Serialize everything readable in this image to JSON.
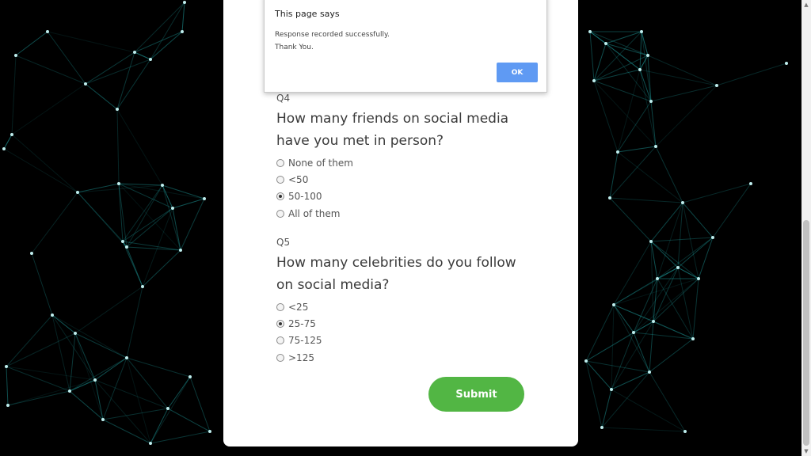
{
  "form": {
    "questions": [
      {
        "number": "Q4",
        "text": "How many friends on social media have you met in person?",
        "options": [
          {
            "label": "None of them",
            "checked": false
          },
          {
            "label": "<50",
            "checked": false
          },
          {
            "label": "50-100",
            "checked": true
          },
          {
            "label": "All of them",
            "checked": false
          }
        ]
      },
      {
        "number": "Q5",
        "text": "How many celebrities do you follow on social media?",
        "options": [
          {
            "label": "<25",
            "checked": false
          },
          {
            "label": "25-75",
            "checked": true
          },
          {
            "label": "75-125",
            "checked": false
          },
          {
            "label": ">125",
            "checked": false
          }
        ]
      }
    ],
    "submit_label": "Submit"
  },
  "dialog": {
    "title": "This page says",
    "message_line1": "Response recorded successfully.",
    "message_line2": "Thank You.",
    "ok_label": "OK"
  },
  "colors": {
    "background": "#000000",
    "network_line": "#1fa3a3",
    "submit": "#52b644",
    "ok_button": "#5f9af3"
  }
}
